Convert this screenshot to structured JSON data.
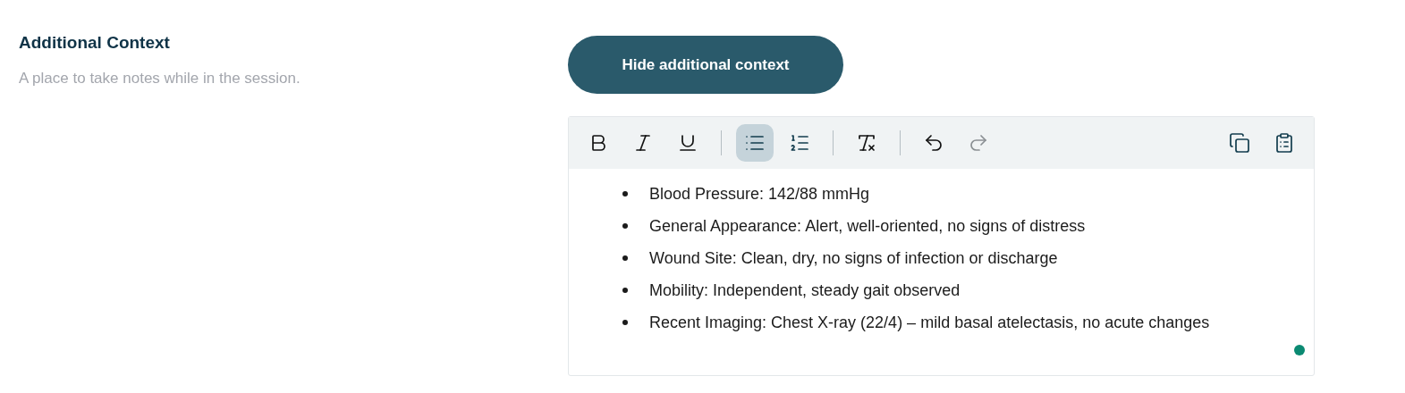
{
  "section": {
    "title": "Additional Context",
    "description": "A place to take notes while in the session."
  },
  "toggle_button": {
    "label": "Hide additional context"
  },
  "editor": {
    "toolbar": [
      {
        "kind": "bold",
        "selected": false,
        "disabled": false
      },
      {
        "kind": "italic",
        "selected": false,
        "disabled": false
      },
      {
        "kind": "underline",
        "selected": false,
        "disabled": false
      },
      {
        "kind": "separator"
      },
      {
        "kind": "bullet_list",
        "selected": true,
        "disabled": false
      },
      {
        "kind": "ordered_list",
        "selected": false,
        "disabled": false
      },
      {
        "kind": "separator"
      },
      {
        "kind": "clear_format",
        "selected": false,
        "disabled": false
      },
      {
        "kind": "separator"
      },
      {
        "kind": "undo",
        "selected": false,
        "disabled": false
      },
      {
        "kind": "redo",
        "selected": false,
        "disabled": true
      },
      {
        "kind": "spacer"
      },
      {
        "kind": "copy",
        "selected": false,
        "disabled": false
      },
      {
        "kind": "paste",
        "selected": false,
        "disabled": false
      }
    ],
    "bullets": [
      "Blood Pressure: 142/88 mmHg",
      "General Appearance: Alert, well-oriented, no signs of distress",
      "Wound Site: Clean, dry, no signs of infection or discharge",
      "Mobility: Independent, steady gait observed",
      "Recent Imaging: Chest X-ray (22/4) – mild basal atelectasis, no acute changes"
    ],
    "status_dot": {
      "color": "#0b8a72"
    }
  }
}
